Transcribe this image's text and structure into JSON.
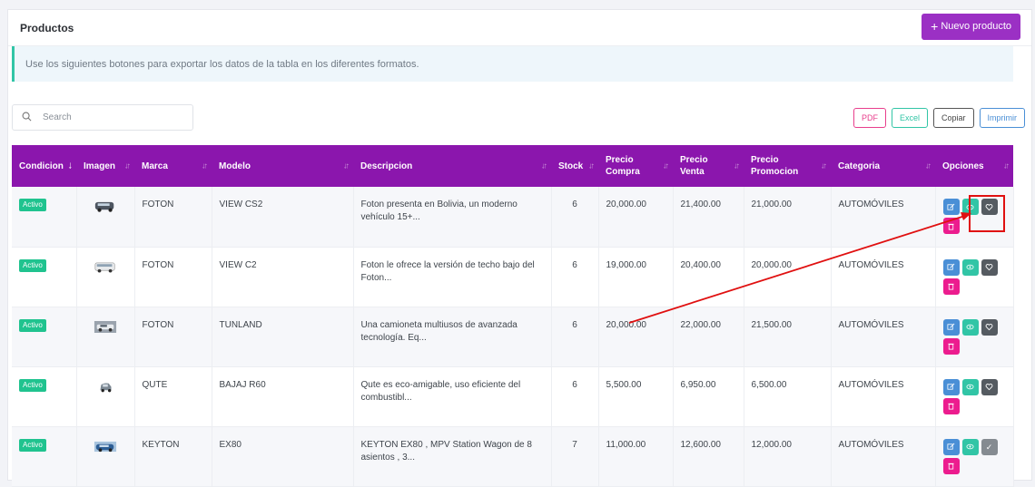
{
  "header": {
    "title": "Productos",
    "new_button_label": "Nuevo producto"
  },
  "alert_text": "Use los siguientes botones para exportar los datos de la tabla en los diferentes formatos.",
  "search": {
    "placeholder": "Search"
  },
  "export_buttons": {
    "pdf": "PDF",
    "excel": "Excel",
    "copy": "Copiar",
    "print": "Imprimir"
  },
  "columns": [
    "Condicion",
    "Imagen",
    "Marca",
    "Modelo",
    "Descripcion",
    "Stock",
    "Precio Compra",
    "Precio Venta",
    "Precio Promocion",
    "Categoria",
    "Opciones"
  ],
  "rows": [
    {
      "condicion": "Activo",
      "marca": "FOTON",
      "modelo": "VIEW CS2",
      "descripcion": "Foton presenta en Bolivia, un moderno vehículo 15+...",
      "stock": "6",
      "precio_compra": "20,000.00",
      "precio_venta": "21,400.00",
      "precio_promocion": "21,000.00",
      "categoria": "AUTOMÓVILES",
      "image_icon": "van-icon"
    },
    {
      "condicion": "Activo",
      "marca": "FOTON",
      "modelo": "VIEW C2",
      "descripcion": "Foton le ofrece la versión de techo bajo del Foton...",
      "stock": "6",
      "precio_compra": "19,000.00",
      "precio_venta": "20,400.00",
      "precio_promocion": "20,000.00",
      "categoria": "AUTOMÓVILES",
      "image_icon": "minibus-icon"
    },
    {
      "condicion": "Activo",
      "marca": "FOTON",
      "modelo": "TUNLAND",
      "descripcion": "Una camioneta multiusos de avanzada tecnología. Eq...",
      "stock": "6",
      "precio_compra": "20,000.00",
      "precio_venta": "22,000.00",
      "precio_promocion": "21,500.00",
      "categoria": "AUTOMÓVILES",
      "image_icon": "pickup-icon"
    },
    {
      "condicion": "Activo",
      "marca": "QUTE",
      "modelo": "BAJAJ R60",
      "descripcion": "Qute es eco-amigable, uso eficiente del combustibl...",
      "stock": "6",
      "precio_compra": "5,500.00",
      "precio_venta": "6,950.00",
      "precio_promocion": "6,500.00",
      "categoria": "AUTOMÓVILES",
      "image_icon": "small-car-icon"
    },
    {
      "condicion": "Activo",
      "marca": "KEYTON",
      "modelo": "EX80",
      "descripcion": "KEYTON EX80 , MPV Station Wagon de 8 asientos , 3...",
      "stock": "7",
      "precio_compra": "11,000.00",
      "precio_venta": "12,600.00",
      "precio_promocion": "12,000.00",
      "categoria": "AUTOMÓVILES",
      "image_icon": "mpv-icon"
    }
  ],
  "colors": {
    "primary": "#9b30c4",
    "header_bg": "#8b16ad",
    "badge": "#20c38f",
    "edit": "#4a8fd6",
    "view": "#31c5a6",
    "favorite": "#555b61",
    "delete": "#ec1c8e",
    "annotation": "#e01010"
  }
}
